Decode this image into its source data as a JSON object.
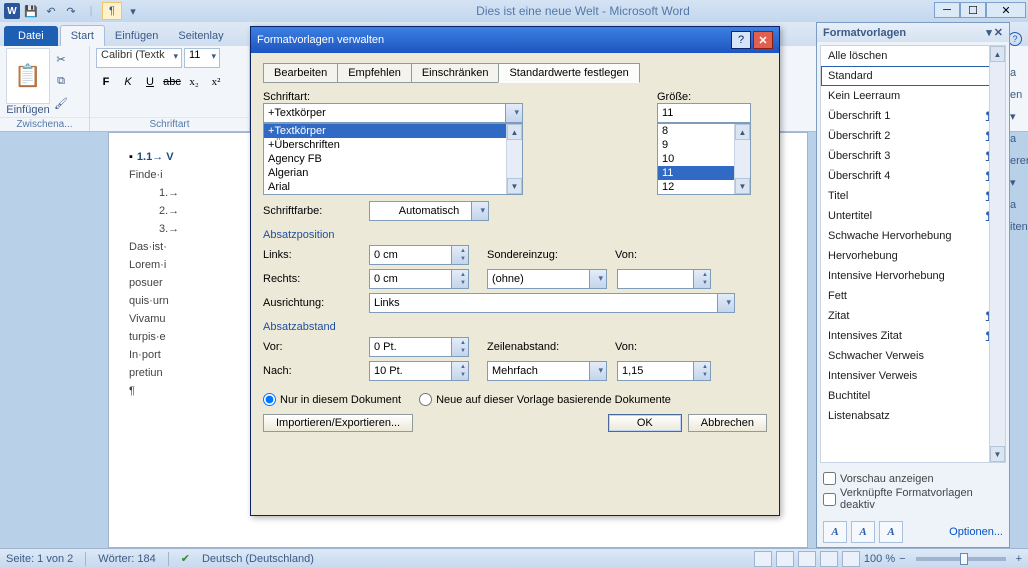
{
  "app": {
    "title": "Dies ist eine neue Welt  -  Microsoft Word"
  },
  "qat": {
    "w": "W"
  },
  "tabs": {
    "file": "Datei",
    "start": "Start",
    "insert": "Einfügen",
    "layout": "Seitenlay"
  },
  "ribbon": {
    "clipboard_label": "Zwischena...",
    "paste_label": "Einfügen",
    "font_label": "Schriftart",
    "font_name": "Calibri (Textk",
    "font_size": "11"
  },
  "doc": {
    "heading": "1.1→ V",
    "line1": "Finde·i",
    "li1": "1.→",
    "li2": "2.→",
    "li3": "3.→",
    "p1": "Das·ist·",
    "p2": "Lorem·i",
    "p3": "posuer",
    "p4": "quis·urn",
    "p5": "Vivamu",
    "p6": "turpis·e",
    "p7": "In·port",
    "p8": "pretiun",
    "pil": "¶"
  },
  "styles_pane": {
    "title": "Formatvorlagen",
    "items": [
      {
        "label": "Alle löschen",
        "sym": ""
      },
      {
        "label": "Standard",
        "sym": "¶",
        "sel": true
      },
      {
        "label": "Kein Leerraum",
        "sym": "¶"
      },
      {
        "label": "Überschrift 1",
        "sym": "¶a",
        "u": true
      },
      {
        "label": "Überschrift 2",
        "sym": "¶a",
        "u": true
      },
      {
        "label": "Überschrift 3",
        "sym": "¶a",
        "u": true
      },
      {
        "label": "Überschrift 4",
        "sym": "¶a",
        "u": true
      },
      {
        "label": "Titel",
        "sym": "¶a",
        "u": true
      },
      {
        "label": "Untertitel",
        "sym": "¶a",
        "u": true
      },
      {
        "label": "Schwache Hervorhebung",
        "sym": "a"
      },
      {
        "label": "Hervorhebung",
        "sym": "a"
      },
      {
        "label": "Intensive Hervorhebung",
        "sym": "a"
      },
      {
        "label": "Fett",
        "sym": "a"
      },
      {
        "label": "Zitat",
        "sym": "¶a",
        "u": true
      },
      {
        "label": "Intensives Zitat",
        "sym": "¶a",
        "u": true
      },
      {
        "label": "Schwacher Verweis",
        "sym": "a"
      },
      {
        "label": "Intensiver Verweis",
        "sym": "a"
      },
      {
        "label": "Buchtitel",
        "sym": "a"
      },
      {
        "label": "Listenabsatz",
        "sym": "¶"
      }
    ],
    "preview": "Vorschau anzeigen",
    "linked": "Verknüpfte Formatvorlagen deaktiv",
    "options": "Optionen..."
  },
  "dialog": {
    "title": "Formatvorlagen verwalten",
    "tabs": {
      "edit": "Bearbeiten",
      "rec": "Empfehlen",
      "restrict": "Einschränken",
      "defaults": "Standardwerte festlegen"
    },
    "font_label": "Schriftart:",
    "font_value": "+Textkörper",
    "font_list": [
      "+Textkörper",
      "+Überschriften",
      "Agency FB",
      "Algerian",
      "Arial"
    ],
    "size_label": "Größe:",
    "size_value": "11",
    "size_list": [
      "8",
      "9",
      "10",
      "11",
      "12"
    ],
    "color_label": "Schriftfarbe:",
    "color_value": "Automatisch",
    "sect_pos": "Absatzposition",
    "left_label": "Links:",
    "left_value": "0 cm",
    "right_label": "Rechts:",
    "right_value": "0 cm",
    "special_label": "Sondereinzug:",
    "special_value": "(ohne)",
    "by_label": "Von:",
    "align_label": "Ausrichtung:",
    "align_value": "Links",
    "sect_spacing": "Absatzabstand",
    "before_label": "Vor:",
    "before_value": "0 Pt.",
    "after_label": "Nach:",
    "after_value": "10 Pt.",
    "line_label": "Zeilenabstand:",
    "line_value": "Mehrfach",
    "at_label": "Von:",
    "at_value": "1,15",
    "radio1": "Nur in diesem Dokument",
    "radio2": "Neue auf dieser Vorlage basierende Dokumente",
    "import": "Importieren/Exportieren...",
    "ok": "OK",
    "cancel": "Abbrechen"
  },
  "status": {
    "page": "Seite: 1 von 2",
    "words": "Wörter: 184",
    "lang": "Deutsch (Deutschland)",
    "zoom": "100 %"
  },
  "side_groups": {
    "g1": "a",
    "g2": "en ▾",
    "g3": "a",
    "g4": "eren ▾",
    "g5": "a",
    "g6": "iten"
  }
}
